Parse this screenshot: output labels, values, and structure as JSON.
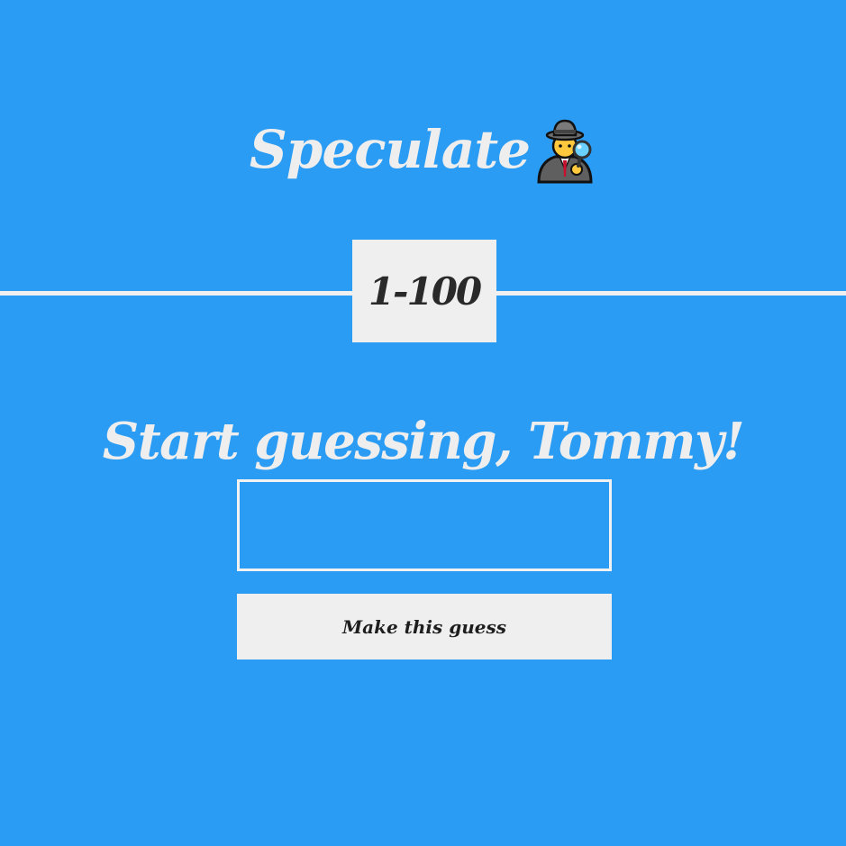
{
  "header": {
    "title": "Speculate",
    "title_icon": "detective-icon"
  },
  "range": {
    "label": "1-100"
  },
  "prompt": {
    "text": "Start guessing, Tommy!"
  },
  "guess_form": {
    "input_value": "",
    "input_placeholder": "",
    "submit_label": "Make this guess"
  },
  "colors": {
    "background": "#2b9cf3",
    "light_text": "#eeeeee",
    "panel": "#efefef",
    "dark_text": "#2a2a2a"
  }
}
